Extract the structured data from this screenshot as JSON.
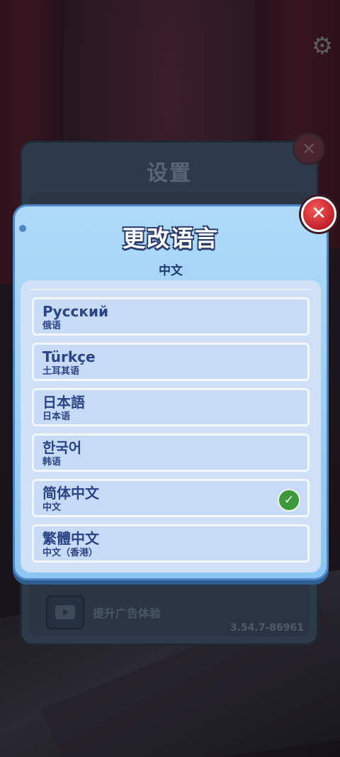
{
  "background": {
    "settings_title": "设置",
    "ad_label": "提升广告体验",
    "version": "3.54.7-86961"
  },
  "modal": {
    "title": "更改语言",
    "current_language": "中文",
    "close_icon": "close-icon",
    "languages": [
      {
        "native": "Русский",
        "translation": "俄语",
        "selected": false
      },
      {
        "native": "Türkçe",
        "translation": "土耳其语",
        "selected": false
      },
      {
        "native": "日本語",
        "translation": "日本语",
        "selected": false
      },
      {
        "native": "한국어",
        "translation": "韩语",
        "selected": false
      },
      {
        "native": "简体中文",
        "translation": "中文",
        "selected": true
      },
      {
        "native": "繁體中文",
        "translation": "中文（香港）",
        "selected": false
      }
    ]
  },
  "colors": {
    "modal_bg": "#aedaf8",
    "text_blue": "#2a4486",
    "check_green": "#3d9a3a",
    "close_red": "#c21f2a"
  }
}
